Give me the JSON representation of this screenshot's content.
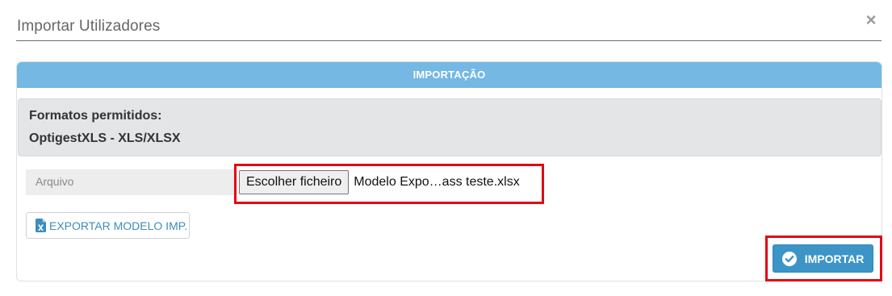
{
  "dialog": {
    "title": "Importar Utilizadores",
    "close_label": "×"
  },
  "panel": {
    "heading": "IMPORTAÇÃO",
    "formats_label": "Formatos permitidos:",
    "formats_value": "OptigestXLS - XLS/XLSX"
  },
  "file_field": {
    "label": "Arquivo",
    "button_label": "Escolher ficheiro",
    "file_name": "Modelo Expo…ass teste.xlsx"
  },
  "actions": {
    "export_label": "EXPORTAR MODELO IMP.",
    "export_icon": "excel-file-icon",
    "import_label": "IMPORTAR",
    "import_icon": "check-circle-icon"
  },
  "colors": {
    "panel_heading": "#74b8e3",
    "import_button": "#3c95c6",
    "highlight": "#e30613"
  }
}
